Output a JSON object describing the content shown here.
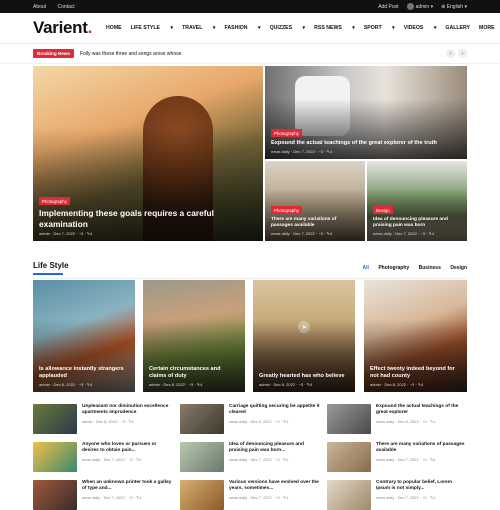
{
  "topbar": {
    "about": "About",
    "contact": "Contact",
    "add_post": "Add Post",
    "user": "admin",
    "language": "English"
  },
  "header": {
    "logo": "Varient",
    "nav": [
      "HOME",
      "LIFE STYLE",
      "TRAVEL",
      "FASHION",
      "QUIZZES",
      "RSS NEWS",
      "SPORT",
      "VIDEOS",
      "GALLERY",
      "MORE"
    ]
  },
  "ticker": {
    "label": "Breaking News",
    "text": "Folly was these three and songs arose whose"
  },
  "hero": [
    {
      "category": "Photography",
      "title": "Implementing these goals requires a careful examination",
      "meta": "admin · Dec 7, 2022 · ◔3 · ✎4"
    },
    {
      "category": "Photography",
      "title": "Expound the actual teachings of the great explorer of the truth",
      "meta": "news daily · Dec 7, 2022 · ◔3 · ✎4"
    },
    {
      "category": "Photography",
      "title": "There are many variations of passages available",
      "meta": "news daily · Dec 7, 2022 · ◔3 · ✎4"
    },
    {
      "category": "Design",
      "title": "Idea of denouncing pleasure and praising pain was born",
      "meta": "news daily · Dec 7, 2022 · ◔3 · ✎4"
    }
  ],
  "lifestyle": {
    "title": "Life Style",
    "tabs": [
      "All",
      "Photography",
      "Business",
      "Design"
    ],
    "cards": [
      {
        "title": "Is allowance instantly strangers applauded",
        "meta": "admin · Dec 8, 2022 · ◔3 · ✎4"
      },
      {
        "title": "Certain circumstances and claims of duty",
        "meta": "admin · Dec 8, 2022 · ◔3 · ✎4"
      },
      {
        "title": "Greatly hearted has who believe",
        "meta": "admin · Dec 8, 2022 · ◔3 · ✎4"
      },
      {
        "title": "Effect twenty indeed beyond for not had county",
        "meta": "admin · Dec 8, 2022 · ◔3 · ✎4"
      }
    ],
    "list": [
      {
        "title": "Unpleasant nor diminution excellence apartments imprudence",
        "meta": "admin · Dec 8, 2022 · ◔3 · ✎1"
      },
      {
        "title": "Carriage quitting securing be appetite it cleared",
        "meta": "news daily · Dec 8, 2022 · ◔3 · ✎1"
      },
      {
        "title": "Expound the actual teachings of the great explorer",
        "meta": "news daily · Dec 8, 2022 · ◔3 · ✎1"
      },
      {
        "title": "Anyone who loves or pursues or desires to obtain pain...",
        "meta": "news daily · Dec 7, 2022 · ◔3 · ✎2"
      },
      {
        "title": "Idea of denouncing pleasure and praising pain was born...",
        "meta": "news daily · Dec 7, 2022 · ◔3 · ✎2"
      },
      {
        "title": "There are many variations of passages available",
        "meta": "news daily · Dec 7, 2022 · ◔3 · ✎4"
      },
      {
        "title": "When an unknown printer took a galley of type and...",
        "meta": "news daily · Dec 7, 2022 · ◔3 · ✎1"
      },
      {
        "title": "Various versions have evolved over the years, sometimes...",
        "meta": "news daily · Dec 7, 2022 · ◔3 · ✎1"
      },
      {
        "title": "Contrary to popular belief, Lorem Ipsum is not simply...",
        "meta": "news daily · Dec 7, 2022 · ◔3 · ✎1"
      }
    ]
  },
  "colors": {
    "accent": "#e02a37",
    "link": "#2563eb"
  },
  "icons": {
    "search": "search-icon",
    "prev": "chevron-left-icon",
    "next": "chevron-right-icon",
    "play": "play-icon"
  }
}
